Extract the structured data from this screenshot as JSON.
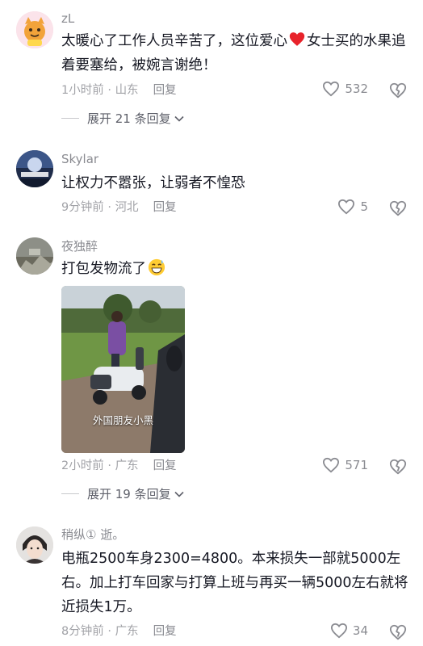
{
  "comments": [
    {
      "username": "zL",
      "text_before": "太暖心了工作人员辛苦了，这位爱心",
      "text_after": "女士买的水果追着要塞给，被婉言谢绝！",
      "time": "1小时前",
      "location": "山东",
      "reply_label": "回复",
      "likes": "532",
      "expand_label": "展开 21 条回复"
    },
    {
      "username": "Skylar",
      "text": "让权力不嚣张，让弱者不惶恐",
      "time": "9分钟前",
      "location": "河北",
      "reply_label": "回复",
      "likes": "5"
    },
    {
      "username": "夜独醉",
      "text": "打包发物流了",
      "image_caption": "外国朋友小黑",
      "time": "2小时前",
      "location": "广东",
      "reply_label": "回复",
      "likes": "571",
      "expand_label": "展开 19 条回复"
    },
    {
      "username": "稍纵① 逝。",
      "text": "电瓶2500车身2300=4800。本来损失一部就5000左右。加上打车回家与打算上班与再买一辆5000左右就将近损失1万。",
      "time": "8分钟前",
      "location": "广东",
      "reply_label": "回复",
      "likes": "34"
    }
  ],
  "icons": {
    "like": "heart-outline-icon",
    "dislike": "broken-heart-icon",
    "expand": "chevron-down-icon",
    "emoji_heart": "red-heart-emoji",
    "emoji_grin": "grinning-sweat-emoji"
  },
  "colors": {
    "text": "#161823",
    "secondary": "#8a8b91",
    "heart": "#fe2c55"
  }
}
